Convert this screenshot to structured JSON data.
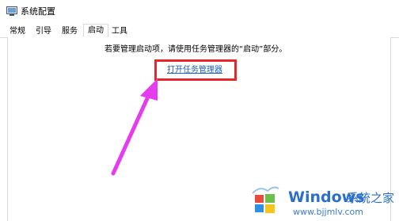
{
  "window": {
    "title": "系统配置",
    "icon": "system-config-icon"
  },
  "tabs": [
    {
      "label": "常规",
      "active": false
    },
    {
      "label": "引导",
      "active": false
    },
    {
      "label": "服务",
      "active": false
    },
    {
      "label": "启动",
      "active": true
    },
    {
      "label": "工具",
      "active": false
    }
  ],
  "startup": {
    "message": "若要管理启动项，请使用任务管理器的“启动”部分。",
    "link_label": "打开任务管理器"
  },
  "annotation": {
    "highlight_color": "#e8262b",
    "arrow_color": "#e63cf0"
  },
  "watermark": {
    "brand": "Windows",
    "brand_cn": "系统之家",
    "url": "www.bjjmlv.com",
    "color": "#2a6fc9"
  }
}
